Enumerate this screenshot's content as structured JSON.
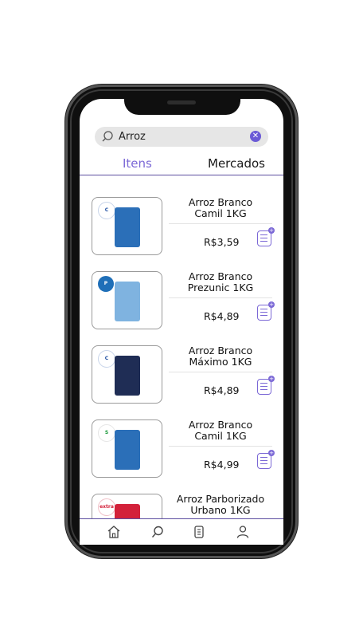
{
  "search": {
    "value": "Arroz"
  },
  "tabs": [
    {
      "label": "Itens",
      "active": true
    },
    {
      "label": "Mercados",
      "active": false
    }
  ],
  "items": [
    {
      "name": "Arroz Branco\nCamil 1KG",
      "price": "R$3,59",
      "store": "Carrefour",
      "pack_color": "#2b6fb8"
    },
    {
      "name": "Arroz Branco\nPrezunic 1KG",
      "price": "R$4,89",
      "store": "Prezunic",
      "pack_color": "#7fb3e0"
    },
    {
      "name": "Arroz Branco\nMáximo 1KG",
      "price": "R$4,89",
      "store": "Carrefour",
      "pack_color": "#1f2d55"
    },
    {
      "name": "Arroz Branco\nCamil 1KG",
      "price": "R$4,99",
      "store": "Supermarket",
      "pack_color": "#2b6fb8"
    },
    {
      "name": "Arroz Parborizado\nUrbano 1KG",
      "price": "",
      "store": "Extra",
      "pack_color": "#d3213a"
    }
  ],
  "colors": {
    "accent": "#7b68d6",
    "divider": "#5d4ea0"
  },
  "nav": [
    "home-icon",
    "search-icon",
    "list-icon",
    "user-icon"
  ]
}
